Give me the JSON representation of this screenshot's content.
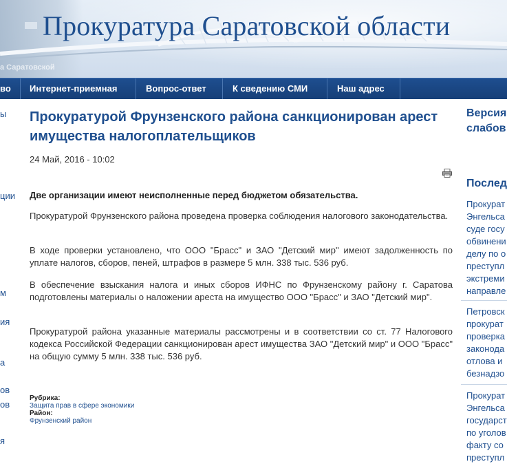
{
  "header": {
    "site_title": "Прокуратура Саратовской области",
    "faded_caption": "а Саратовской"
  },
  "nav": {
    "items": [
      {
        "label": "во"
      },
      {
        "label": "Интернет-приемная"
      },
      {
        "label": "Вопрос-ответ"
      },
      {
        "label": "К сведению СМИ"
      },
      {
        "label": "Наш адрес"
      }
    ]
  },
  "left_sidebar": {
    "fragments": [
      "ы",
      "ции",
      "м",
      "ия",
      "а",
      "ов",
      "ов",
      "я"
    ]
  },
  "article": {
    "title": "Прокуратурой Фрунзенского района санкционирован арест имущества налогоплательщиков",
    "date": "24 Май, 2016 - 10:02",
    "lead": "Две организации имеют неисполненные перед бюджетом обязательства.",
    "paragraphs": [
      "Прокуратурой Фрунзенского района проведена проверка соблюдения  налогового законодательства.",
      "В ходе проверки установлено, что ООО \"Брасс\" и ЗАО \"Детский мир\" имеют задолженность по уплате налогов, сборов, пеней, штрафов в размере 5 млн. 338 тыс. 536 руб.",
      "В обеспечение взыскания налога и иных сборов ИФНС по Фрунзенскому району г. Саратова подготовлены материалы о наложении ареста на имущество ООО \"Брасс\" и ЗАО \"Детский мир\".",
      "Прокуратурой района указанные материалы рассмотрены и в соответствии со ст. 77 Налогового кодекса Российской Федерации санкционирован арест имущества ЗАО \"Детский мир\" и ООО \"Брасс\" на общую сумму 5 млн. 338 тыс. 536 руб."
    ],
    "rubric_label": "Рубрика:",
    "rubric_value": "Защита прав в сфере экономики",
    "district_label": "Район:",
    "district_value": "Фрунзенский район"
  },
  "right_column": {
    "version_lines": [
      "Версия",
      "слабов"
    ],
    "latest_heading": "Послед",
    "news_lines": [
      "Прокурат",
      "Энгельса",
      "суде госу",
      "обвинени",
      "делу по о",
      "преступл",
      "экстреми",
      "направле",
      "Петровск",
      "прокурат",
      "проверка",
      "законода",
      "отлова и",
      "безнадзо",
      "Прокурат",
      "Энгельса",
      "государст",
      "по уголов",
      "факту со",
      "преступл"
    ]
  },
  "icons": {
    "print": "print-icon"
  },
  "colors": {
    "brand_blue": "#1f4f8f",
    "nav_bg": "#1e4e8f"
  }
}
